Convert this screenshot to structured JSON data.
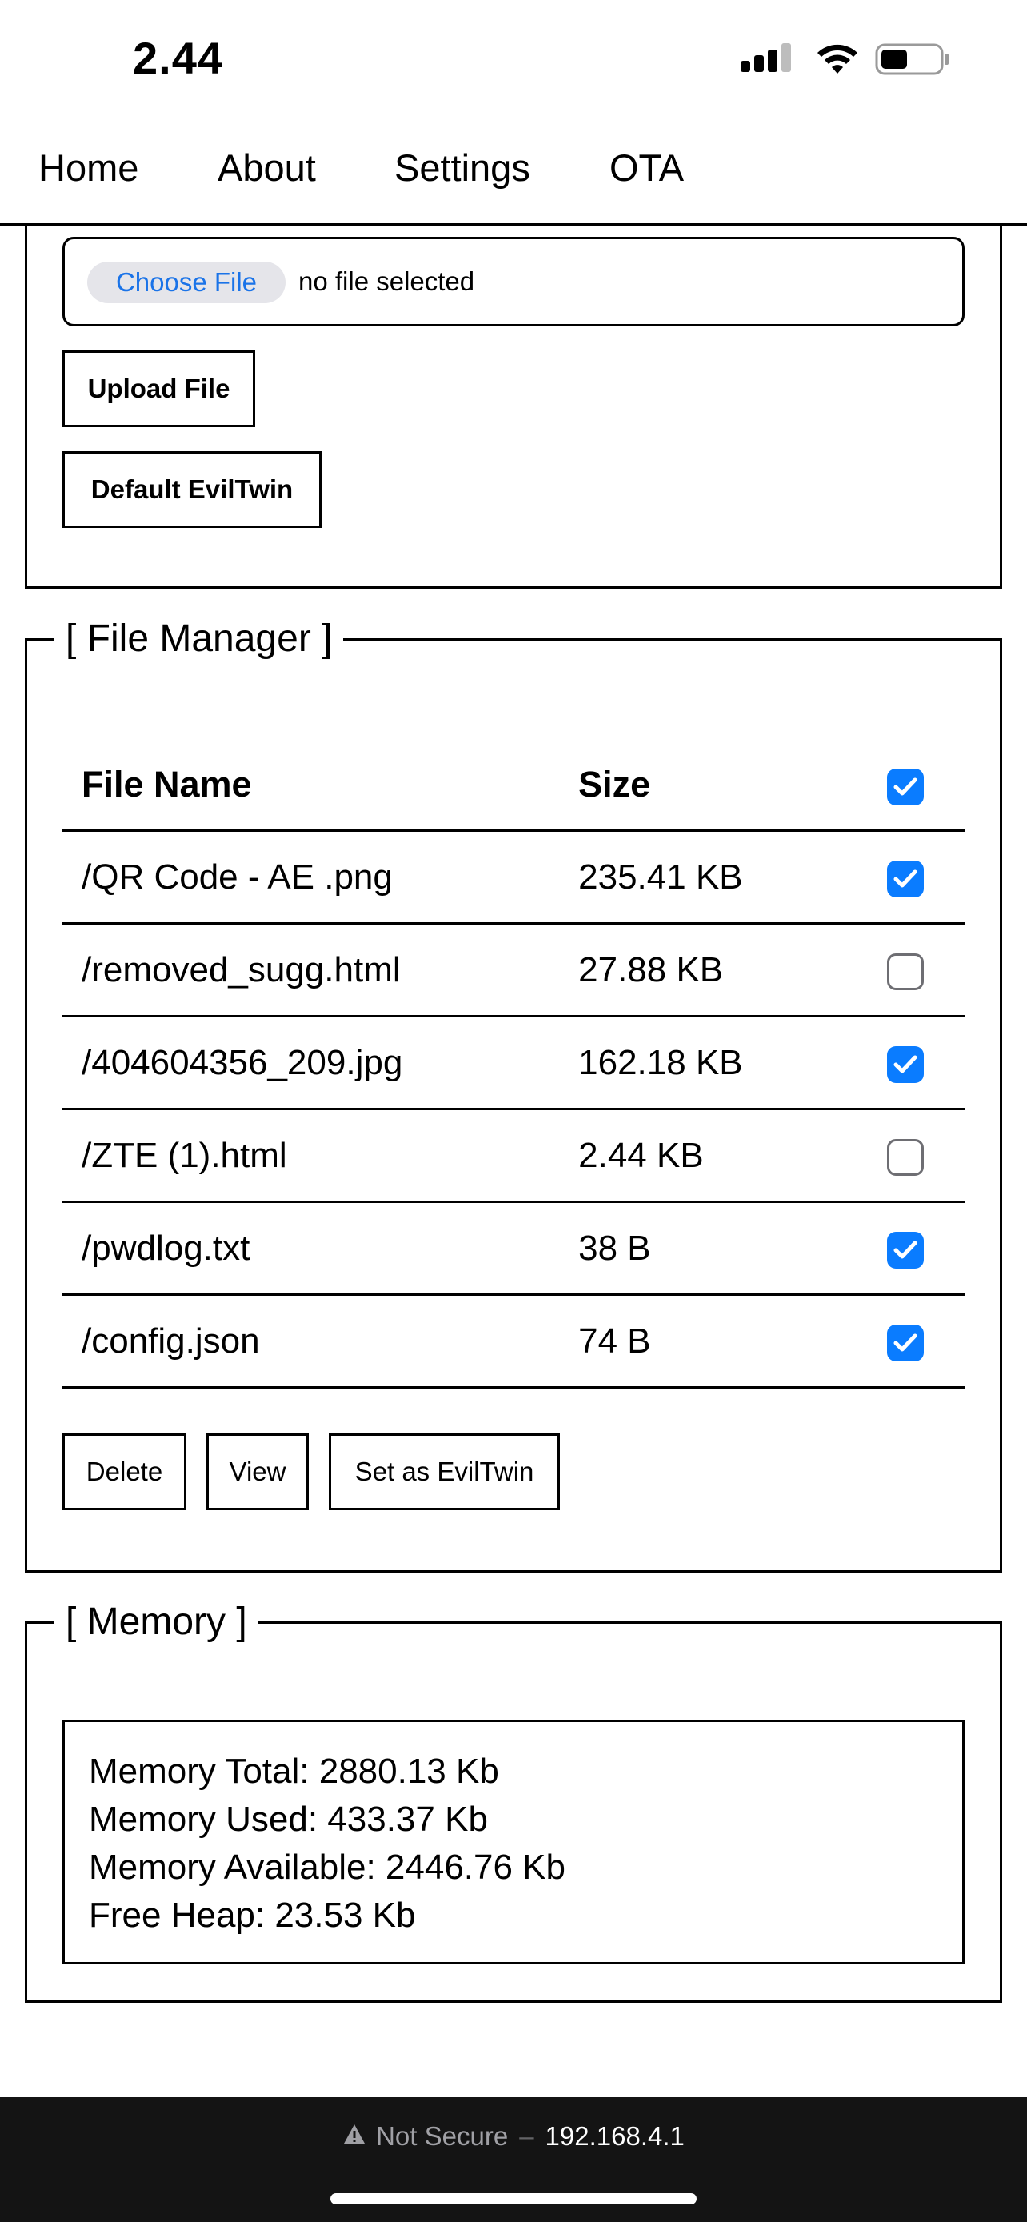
{
  "status_bar": {
    "time": "2.44"
  },
  "nav": {
    "items": [
      {
        "label": "Home"
      },
      {
        "label": "About"
      },
      {
        "label": "Settings"
      },
      {
        "label": "OTA"
      }
    ]
  },
  "upload": {
    "choose_file_label": "Choose File",
    "file_status": "no file selected",
    "upload_button": "Upload File",
    "default_button": "Default EvilTwin"
  },
  "file_manager": {
    "legend": "[ File Manager ]",
    "header": {
      "name": "File Name",
      "size": "Size",
      "select_all_checked": true
    },
    "rows": [
      {
        "name": "/QR Code - AE .png",
        "size": "235.41 KB",
        "checked": true
      },
      {
        "name": "/removed_sugg.html",
        "size": "27.88 KB",
        "checked": false
      },
      {
        "name": "/404604356_209.jpg",
        "size": "162.18 KB",
        "checked": true
      },
      {
        "name": "/ZTE (1).html",
        "size": "2.44 KB",
        "checked": false
      },
      {
        "name": "/pwdlog.txt",
        "size": "38 B",
        "checked": true
      },
      {
        "name": "/config.json",
        "size": "74 B",
        "checked": true
      }
    ],
    "buttons": {
      "delete": "Delete",
      "view": "View",
      "set_eviltwin": "Set as EvilTwin"
    }
  },
  "memory": {
    "legend": "[ Memory ]",
    "lines": [
      "Memory Total: 2880.13 Kb",
      "Memory Used: 433.37 Kb",
      "Memory Available: 2446.76 Kb",
      "Free Heap: 23.53 Kb"
    ]
  },
  "browser_bar": {
    "security_label": "Not Secure",
    "separator": "–",
    "url": "192.168.4.1"
  },
  "colors": {
    "checkbox_on": "#0a7cff",
    "choose_file_text": "#1a73e8",
    "bottom_bar_bg": "#141414"
  }
}
